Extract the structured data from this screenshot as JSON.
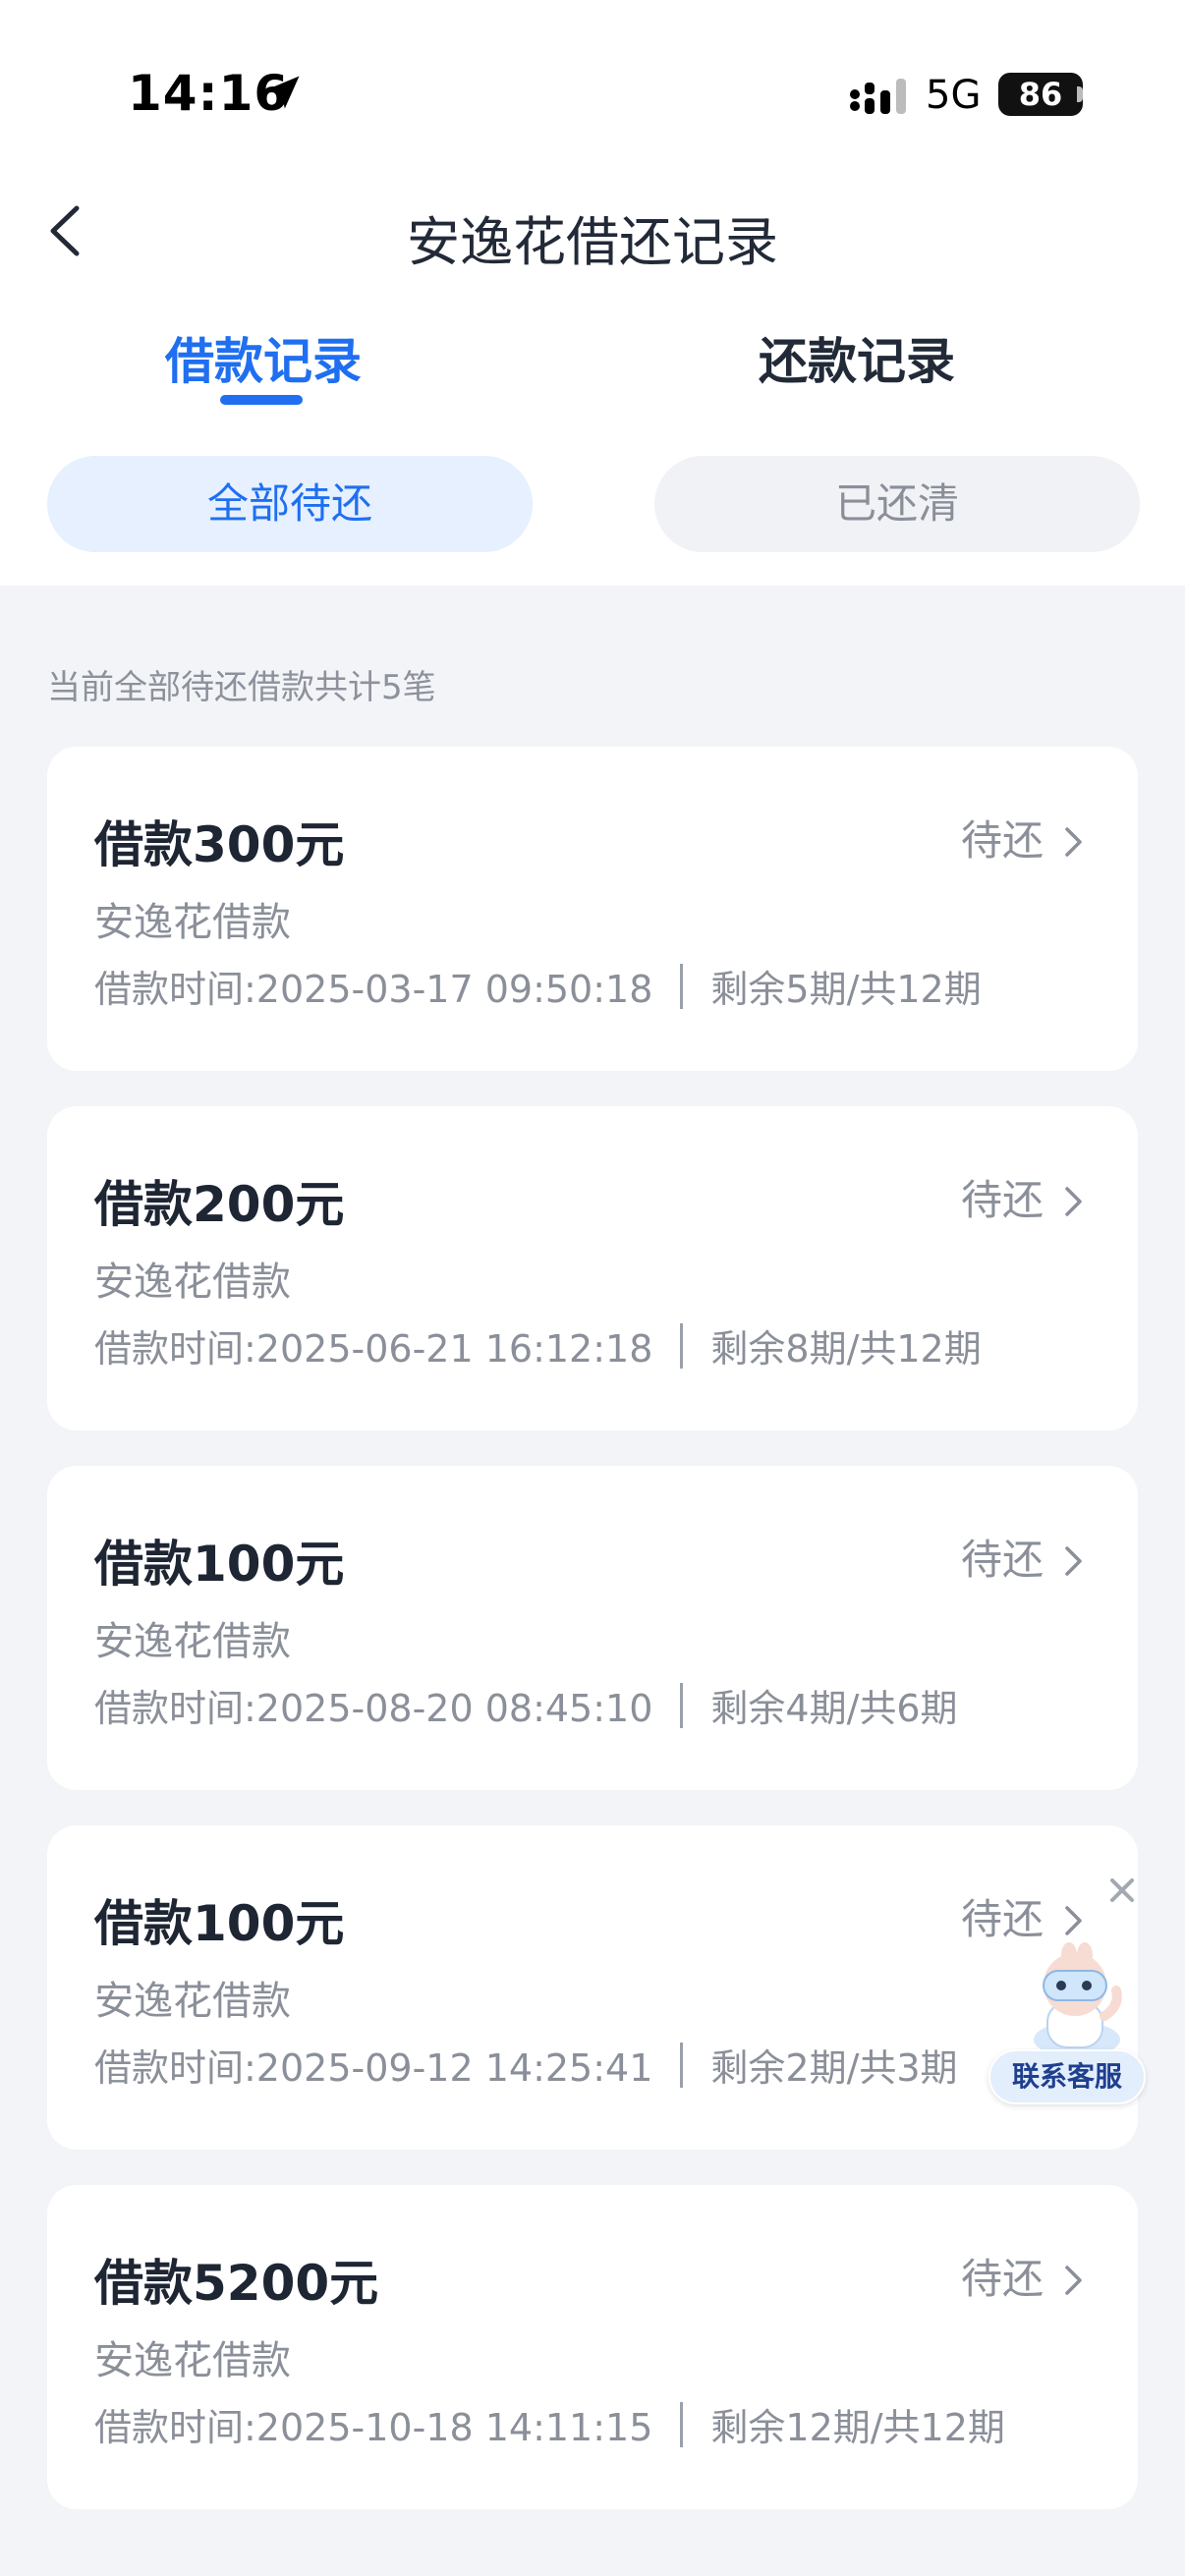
{
  "status_bar": {
    "time": "14:16",
    "network": "5G",
    "battery": "86"
  },
  "header": {
    "title": "安逸花借还记录"
  },
  "tabs": [
    {
      "label": "借款记录",
      "active": true
    },
    {
      "label": "还款记录",
      "active": false
    }
  ],
  "filters": [
    {
      "label": "全部待还",
      "active": true
    },
    {
      "label": "已还清",
      "active": false
    }
  ],
  "summary": "当前全部待还借款共计5笔",
  "loans": [
    {
      "title": "借款300元",
      "status": "待还",
      "subtitle": "安逸花借款",
      "time": "借款时间:2025-03-17 09:50:18",
      "periods": "剩余5期/共12期"
    },
    {
      "title": "借款200元",
      "status": "待还",
      "subtitle": "安逸花借款",
      "time": "借款时间:2025-06-21 16:12:18",
      "periods": "剩余8期/共12期"
    },
    {
      "title": "借款100元",
      "status": "待还",
      "subtitle": "安逸花借款",
      "time": "借款时间:2025-08-20 08:45:10",
      "periods": "剩余4期/共6期"
    },
    {
      "title": "借款100元",
      "status": "待还",
      "subtitle": "安逸花借款",
      "time": "借款时间:2025-09-12 14:25:41",
      "periods": "剩余2期/共3期"
    },
    {
      "title": "借款5200元",
      "status": "待还",
      "subtitle": "安逸花借款",
      "time": "借款时间:2025-10-18 14:11:15",
      "periods": "剩余12期/共12期"
    }
  ],
  "floating_service": {
    "label": "联系客服",
    "icon": "mascot-icon"
  },
  "colors": {
    "accent": "#1f6ff0",
    "pill_active_bg": "#e6f0fe",
    "page_bg": "#f3f4f8"
  }
}
